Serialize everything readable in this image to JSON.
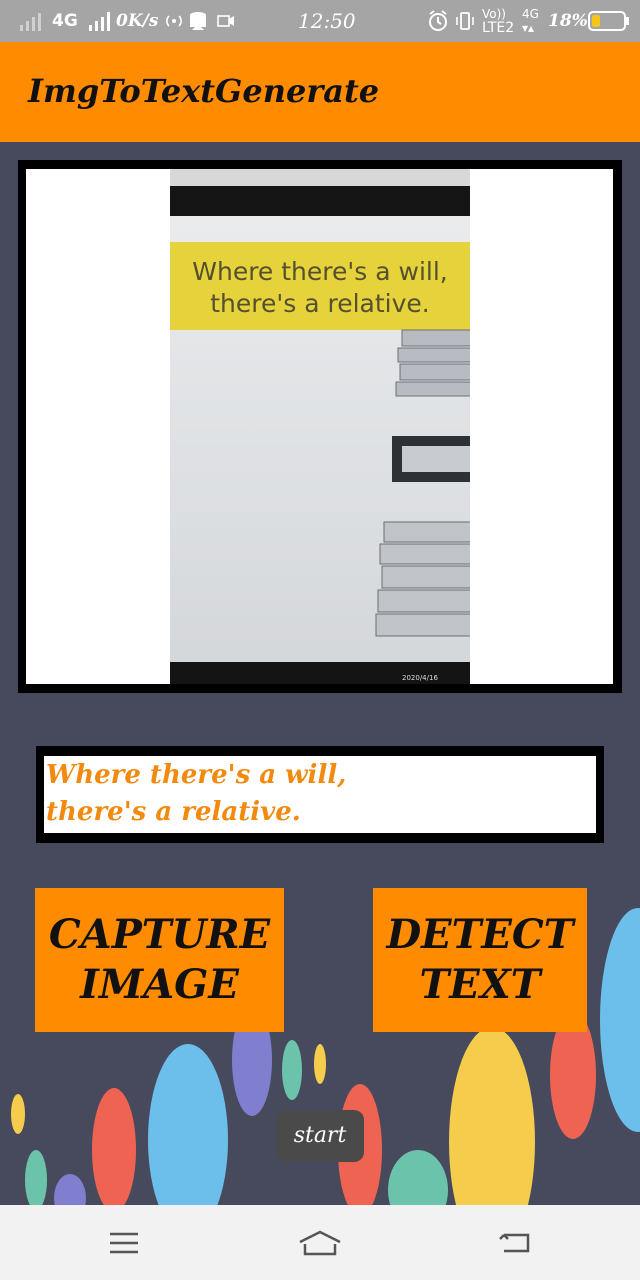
{
  "status_bar": {
    "network_1": "4G",
    "speed": "0K/s",
    "time": "12:50",
    "volte_top": "Vo))",
    "volte_bottom": "LTE2",
    "network_2": "4G",
    "battery": "18%"
  },
  "app_bar": {
    "title": "ImgToTextGenerate"
  },
  "preview": {
    "photo_caption_line1": "Where there's a will,",
    "photo_caption_line2": "there's a relative.",
    "photo_timestamp": "2020/4/16"
  },
  "result": {
    "line1": "Where there's a will,",
    "line2": "there's a relative."
  },
  "buttons": {
    "capture_line1": "CAPTURE",
    "capture_line2": "IMAGE",
    "detect_line1": "DETECT",
    "detect_line2": "TEXT"
  },
  "toast": {
    "message": "start"
  },
  "colors": {
    "accent": "#ff8c00",
    "background": "#474a5c",
    "result_text": "#f28a10"
  }
}
